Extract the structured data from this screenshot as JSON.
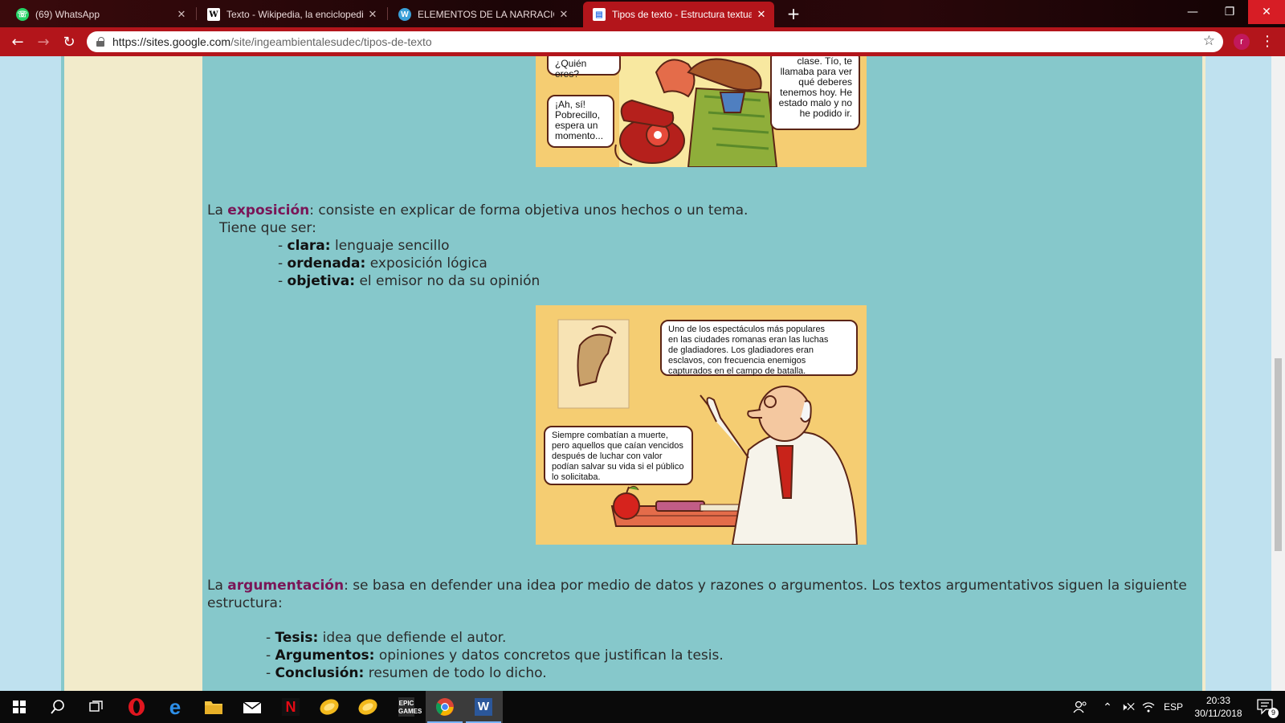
{
  "browser": {
    "tabs": [
      {
        "title": "(69) WhatsApp",
        "icon": "whatsapp-icon",
        "color": "#25d366",
        "glyph": "☏"
      },
      {
        "title": "Texto - Wikipedia, la enciclopedia",
        "icon": "wikipedia-icon",
        "color": "#ffffff",
        "glyph": "W"
      },
      {
        "title": "ELEMENTOS DE LA NARRACION",
        "icon": "wordpress-icon",
        "color": "#3aa0d8",
        "glyph": "W"
      },
      {
        "title": "Tipos de texto - Estructura textual",
        "icon": "google-sites-icon",
        "color": "#3f7be8",
        "glyph": "▤"
      }
    ],
    "url_host": "https://sites.google.com",
    "url_path": "/site/ingeambientalesudec/tipos-de-texto",
    "profile_initial": "r"
  },
  "comic_top": {
    "bubble_left_top": "¿Quién eres?",
    "bubble_left_bottom": "¡Ah, sí!\nPobrecillo,\nespera un\nmomento...",
    "bubble_right": "clase. Tío, te\nllamaba para ver\nqué deberes\ntenemos hoy. He\nestado malo y no\nhe podido ir."
  },
  "exposicion": {
    "prefix": "La ",
    "term": "exposición",
    "definition": ": consiste en explicar de forma objetiva unos hechos o un tema.",
    "intro": "Tiene que ser:",
    "items": [
      {
        "dash": "- ",
        "term": "clara:",
        "text": " lenguaje sencillo"
      },
      {
        "dash": "- ",
        "term": "ordenada:",
        "text": " exposición lógica"
      },
      {
        "dash": "- ",
        "term": "objetiva:",
        "text": " el emisor no da su opinión"
      }
    ]
  },
  "comic_middle": {
    "bubble_top": "Uno de los espectáculos más populares\nen las ciudades romanas eran las luchas\nde gladiadores. Los gladiadores eran\nesclavos, con frecuencia enemigos\ncapturados en el campo de batalla.",
    "bubble_bottom": "Siempre combatían a muerte,\npero aquellos que caían vencidos\ndespués de luchar con valor\npodían salvar su vida si el público\nlo solicitaba."
  },
  "argumentacion": {
    "prefix": "La ",
    "term": "argumentación",
    "definition": ": se basa en defender una idea por medio de datos y razones o  argumentos. Los textos argumentativos siguen la siguiente",
    "definition_cont": "estructura:",
    "items": [
      {
        "dash": "- ",
        "term": "Tesis:",
        "text": " idea que defiende el autor."
      },
      {
        "dash": "- ",
        "term": "Argumentos:",
        "text": " opiniones y datos concretos que justifican la tesis."
      },
      {
        "dash": "- ",
        "term": "Conclusión:",
        "text": " resumen de todo lo dicho."
      }
    ]
  },
  "taskbar": {
    "language": "ESP",
    "time": "20:33",
    "date": "30/11/2018",
    "notification_count": "9"
  }
}
